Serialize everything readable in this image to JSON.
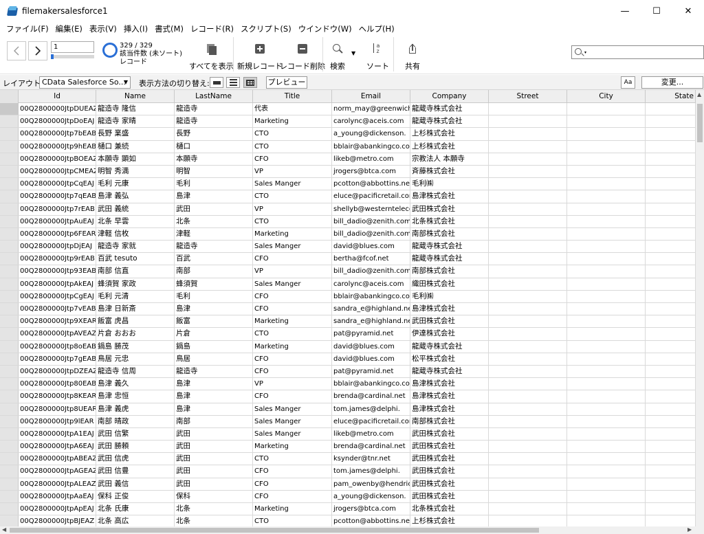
{
  "window": {
    "title": "filemakersalesforce1",
    "minimize": "—",
    "maximize": "☐",
    "close": "✕"
  },
  "menu": [
    "ファイル(F)",
    "編集(E)",
    "表示(V)",
    "挿入(I)",
    "書式(M)",
    "レコード(R)",
    "スクリプト(S)",
    "ウインドウ(W)",
    "ヘルプ(H)"
  ],
  "toolbar": {
    "record_number": "1",
    "record_progress": 0.003,
    "record_count": "329 / 329",
    "found_label": "該当件数 (未ソート)",
    "records_label": "レコード",
    "show_all": "すべてを表示",
    "new_record": "新規レコード",
    "delete_record": "レコード削除",
    "find": "検索",
    "sort": "ソート",
    "share": "共有",
    "search_icon": "magnifier-icon",
    "accent_color": "#2a6fd6"
  },
  "layout_bar": {
    "layout_label": "レイアウト:",
    "layout_value": "CData Salesforce So...",
    "view_as_label": "表示方法の切り替え:",
    "preview": "プレビュー",
    "format_icon": "Aa",
    "edit_layout": "変更..."
  },
  "table": {
    "columns": [
      "Id",
      "Name",
      "LastName",
      "Title",
      "Email",
      "Company",
      "Street",
      "City",
      "State"
    ],
    "rows": [
      [
        "00Q2800000JtpDUEAZ",
        "龍造寺 隆信",
        "龍造寺",
        "代表",
        "norm_may@greenwich.",
        "龍蔵寺株式会社"
      ],
      [
        "00Q2800000JtpDoEAJ",
        "龍造寺 家晴",
        "龍造寺",
        "Marketing",
        "carolync@aceis.com",
        "龍蔵寺株式会社"
      ],
      [
        "00Q2800000Jtp7bEAB",
        "長野 業盛",
        "長野",
        "CTO",
        "a_young@dickenson.",
        "上杉株式会社"
      ],
      [
        "00Q2800000Jtp9hEAB",
        "樋口 兼続",
        "樋口",
        "CTO",
        "bblair@abankingco.com",
        "上杉株式会社"
      ],
      [
        "00Q2800000JtpBOEAZ",
        "本願寺 顕如",
        "本願寺",
        "CFO",
        "likeb@metro.com",
        "宗教法人 本願寺"
      ],
      [
        "00Q2800000JtpCMEAZ",
        "明智 秀満",
        "明智",
        "VP",
        "jrogers@btca.com",
        "斉藤株式会社"
      ],
      [
        "00Q2800000JtpCqEAJ",
        "毛利 元康",
        "毛利",
        "Sales Manger",
        "pcotton@abbottins.net",
        "毛利㈱"
      ],
      [
        "00Q2800000Jtp7qEAB",
        "島津 義弘",
        "島津",
        "CTO",
        "eluce@pacificretail.com",
        "島津株式会社"
      ],
      [
        "00Q2800000Jtp7rEAB",
        "武田 義統",
        "武田",
        "VP",
        "shellyb@westerntelecо",
        "武田株式会社"
      ],
      [
        "00Q2800000JtpAuEAJ",
        "北条 早雲",
        "北条",
        "CTO",
        "bill_dadio@zenith.com",
        "北条株式会社"
      ],
      [
        "00Q2800000Jtp6FEAR",
        "津軽 信枚",
        "津軽",
        "Marketing",
        "bill_dadio@zenith.com",
        "南部株式会社"
      ],
      [
        "00Q2800000JtpDjEAJ",
        "龍造寺 家就",
        "龍造寺",
        "Sales Manger",
        "david@blues.com",
        "龍蔵寺株式会社"
      ],
      [
        "00Q2800000Jtp9rEAB",
        "百武 tesuto",
        "百武",
        "CFO",
        "bertha@fcof.net",
        "龍蔵寺株式会社"
      ],
      [
        "00Q2800000Jtp93EAB",
        "南部 信直",
        "南部",
        "VP",
        "bill_dadio@zenith.com",
        "南部株式会社"
      ],
      [
        "00Q2800000JtpAkEAJ",
        "蜂須賀 家政",
        "蜂須賀",
        "Sales Manger",
        "carolync@aceis.com",
        "織田株式会社"
      ],
      [
        "00Q2800000JtpCgEAJ",
        "毛利 元清",
        "毛利",
        "CFO",
        "bblair@abankingco.com",
        "毛利㈱"
      ],
      [
        "00Q2800000Jtp7vEAB",
        "島津 日新斎",
        "島津",
        "CFO",
        "sandra_e@highland.net",
        "島津株式会社"
      ],
      [
        "00Q2800000Jtp9XEAR",
        "飯富 虎昌",
        "飯富",
        "Marketing",
        "sandra_e@highland.net",
        "武田株式会社"
      ],
      [
        "00Q2800000JtpAVEAZ",
        "片倉 おおお",
        "片倉",
        "CTO",
        "pat@pyramid.net",
        "伊達株式会社"
      ],
      [
        "00Q2800000Jtp8oEAB",
        "鍋島 勝茂",
        "鍋島",
        "Marketing",
        "david@blues.com",
        "龍蔵寺株式会社"
      ],
      [
        "00Q2800000Jtp7gEAB",
        "鳥居 元忠",
        "鳥居",
        "CFO",
        "david@blues.com",
        "松平株式会社"
      ],
      [
        "00Q2800000JtpDZEAZ",
        "龍造寺 信周",
        "龍造寺",
        "CFO",
        "pat@pyramid.net",
        "龍蔵寺株式会社"
      ],
      [
        "00Q2800000Jtp80EAB",
        "島津 義久",
        "島津",
        "VP",
        "bblair@abankingco.com",
        "島津株式会社"
      ],
      [
        "00Q2800000Jtp8KEAR",
        "島津 忠恒",
        "島津",
        "CFO",
        "brenda@cardinal.net",
        "島津株式会社"
      ],
      [
        "00Q2800000Jtp8UEAR",
        "島津 義虎",
        "島津",
        "Sales Manger",
        "tom.james@delphi.",
        "島津株式会社"
      ],
      [
        "00Q2800000Jtp9lEAR",
        "南部 晴政",
        "南部",
        "Sales Manger",
        "eluce@pacificretail.com",
        "南部株式会社"
      ],
      [
        "00Q2800000JtpA1EAJ",
        "武田 信繁",
        "武田",
        "Sales Manger",
        "likeb@metro.com",
        "武田株式会社"
      ],
      [
        "00Q2800000JtpA6EAJ",
        "武田 勝頼",
        "武田",
        "Marketing",
        "brenda@cardinal.net",
        "武田株式会社"
      ],
      [
        "00Q2800000JtpABEAZ",
        "武田 信虎",
        "武田",
        "CTO",
        "ksynder@tnr.net",
        "武田株式会社"
      ],
      [
        "00Q2800000JtpAGEAZ",
        "武田 信豊",
        "武田",
        "CFO",
        "tom.james@delphi.",
        "武田株式会社"
      ],
      [
        "00Q2800000JtpALEAZ",
        "武田 義信",
        "武田",
        "CFO",
        "pam_owenby@hendricks",
        "武田株式会社"
      ],
      [
        "00Q2800000JtpAaEAJ",
        "保科 正俊",
        "保科",
        "CFO",
        "a_young@dickenson.",
        "武田株式会社"
      ],
      [
        "00Q2800000JtpApEAJ",
        "北条 氏康",
        "北条",
        "Marketing",
        "jrogers@btca.com",
        "北条株式会社"
      ],
      [
        "00Q2800000JtpBJEAZ",
        "北条 高広",
        "北条",
        "CTO",
        "pcotton@abbottins.net",
        "上杉株式会社"
      ]
    ]
  }
}
